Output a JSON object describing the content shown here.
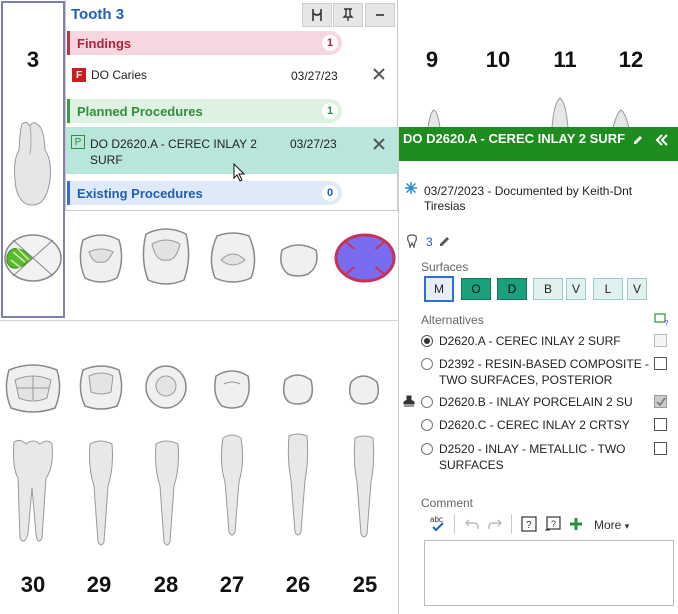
{
  "upper_teeth": [
    {
      "number": "3"
    },
    {
      "number": "9"
    },
    {
      "number": "10"
    },
    {
      "number": "11"
    },
    {
      "number": "12"
    }
  ],
  "lower_teeth": [
    "30",
    "29",
    "28",
    "27",
    "26",
    "25"
  ],
  "popup": {
    "title": "Tooth 3",
    "buttons": [
      "tooth-filter-icon",
      "pin-icon",
      "minimize-icon"
    ],
    "findings": {
      "label": "Findings",
      "count": "1",
      "color": "#f7d7df",
      "text_color": "#b0213a"
    },
    "finding_item": {
      "badge": "F",
      "text": "DO Caries",
      "date": "03/27/23"
    },
    "planned": {
      "label": "Planned Procedures",
      "count": "1",
      "color": "#dff1e2",
      "text_color": "#2f8f3a"
    },
    "planned_item": {
      "badge": "P",
      "text": "DO D2620.A - CEREC INLAY 2 SURF",
      "date": "03/27/23"
    },
    "existing": {
      "label": "Existing Procedures",
      "count": "0",
      "color": "#dfe9f7",
      "text_color": "#2060b0"
    }
  },
  "panel": {
    "title": "DO D2620.A - CEREC INLAY 2 SURF",
    "documented": "03/27/2023 - Documented by Keith-Dnt Tiresias",
    "tooth_ref": "3",
    "surfaces_label": "Surfaces",
    "surfaces": [
      {
        "label": "M",
        "state": "outlined"
      },
      {
        "label": "O",
        "state": "selected"
      },
      {
        "label": "D",
        "state": "selected"
      },
      {
        "label": "B",
        "state": "light"
      },
      {
        "label": "V",
        "state": "light"
      },
      {
        "label": "L",
        "state": "light"
      },
      {
        "label": "V",
        "state": "light"
      }
    ],
    "alternatives_label": "Alternatives",
    "alternatives": [
      {
        "text": "D2620.A - CEREC INLAY 2 SURF",
        "selected": true,
        "checkbox": "disabled"
      },
      {
        "text": "D2392 - RESIN-BASED COMPOSITE - TWO SURFACES, POSTERIOR",
        "selected": false,
        "checkbox": "empty"
      },
      {
        "text": "D2620.B - INLAY PORCELAIN 2 SU",
        "selected": false,
        "checkbox": "checked"
      },
      {
        "text": "D2620.C - CEREC INLAY 2 CRTSY",
        "selected": false,
        "checkbox": "empty"
      },
      {
        "text": "D2520 - INLAY - METALLIC - TWO SURFACES",
        "selected": false,
        "checkbox": "empty"
      }
    ],
    "comment_label": "Comment",
    "toolbar_more": "More"
  }
}
